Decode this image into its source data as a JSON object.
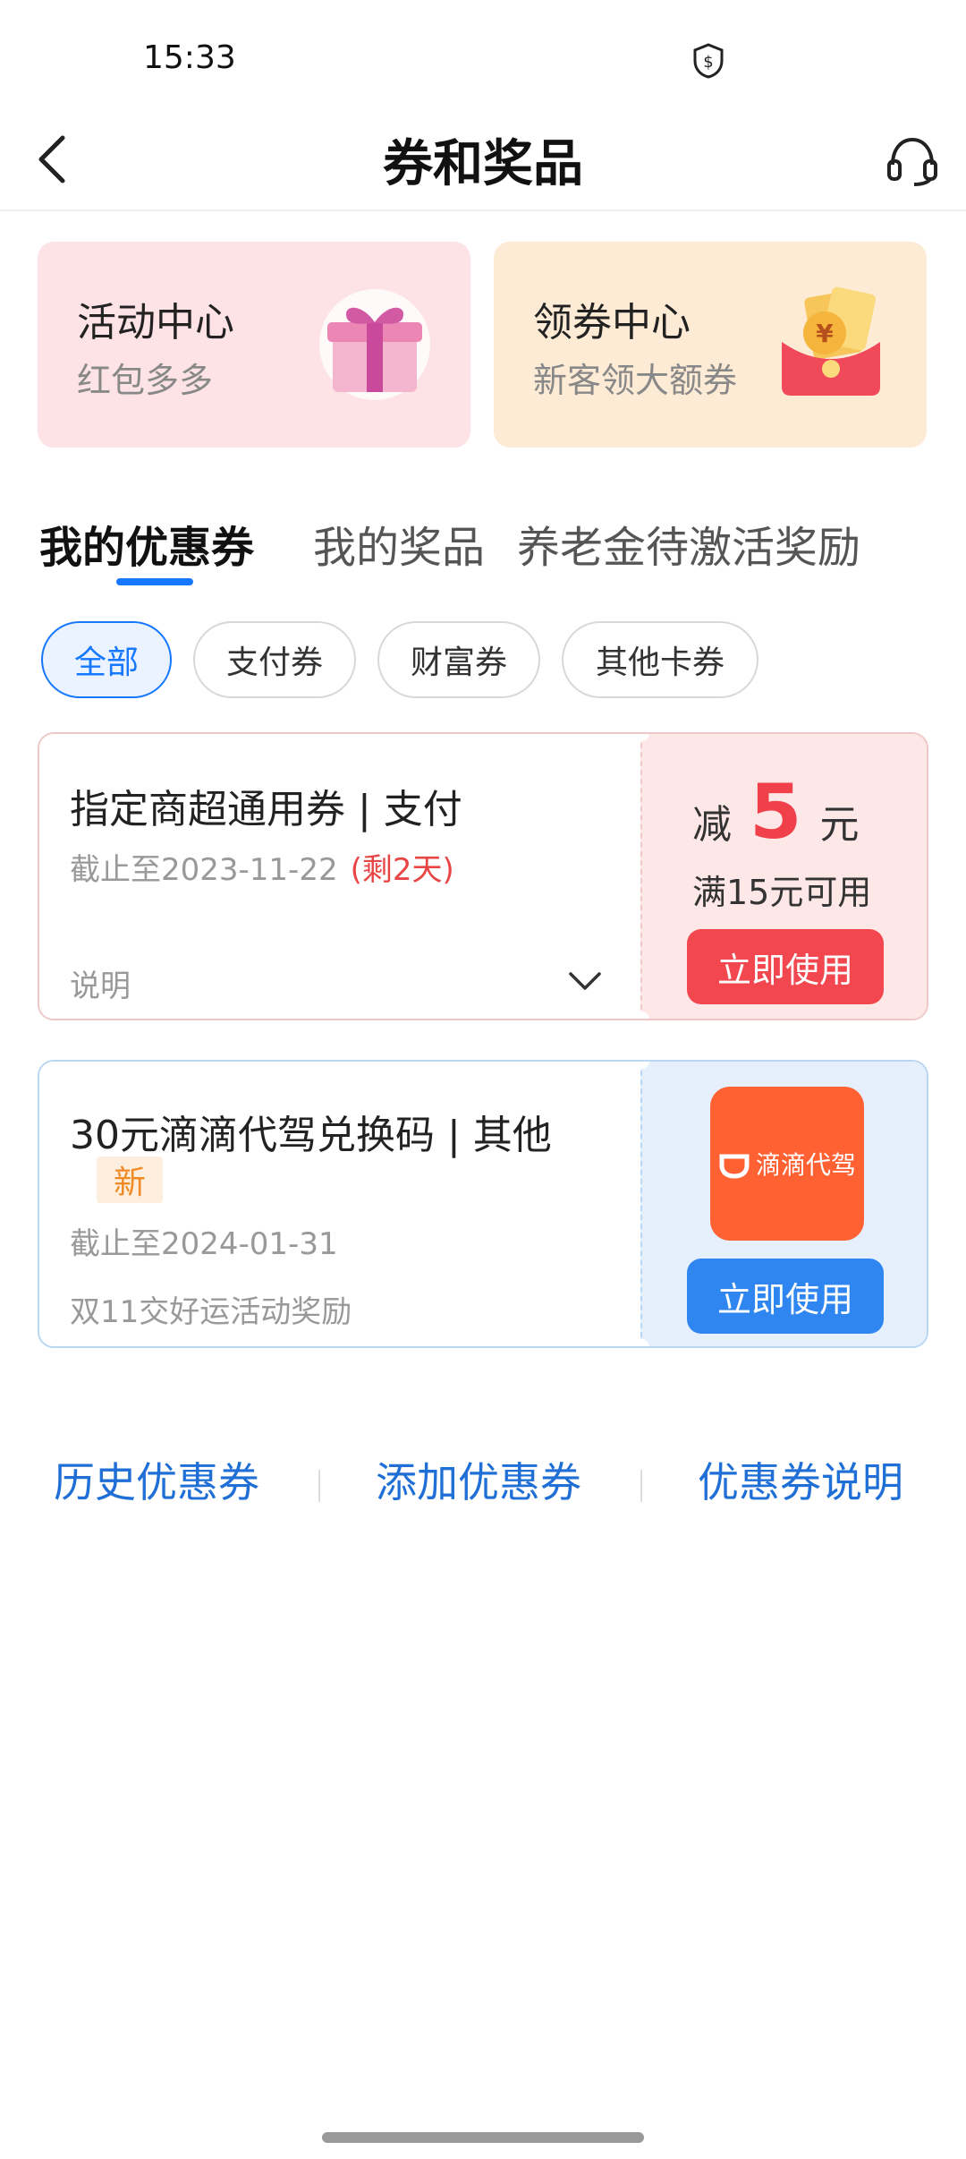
{
  "status_bar": {
    "time": "15:33",
    "shield_icon": "shield-dollar-icon"
  },
  "nav": {
    "title": "券和奖品",
    "back_icon": "chevron-left-icon",
    "service_icon": "headset-icon"
  },
  "promos": [
    {
      "title": "活动中心",
      "subtitle": "红包多多",
      "icon": "gift-box-icon"
    },
    {
      "title": "领券中心",
      "subtitle": "新客领大额券",
      "icon": "red-envelope-icon"
    }
  ],
  "tabs": [
    {
      "label": "我的优惠券",
      "active": true
    },
    {
      "label": "我的奖品",
      "active": false
    },
    {
      "label": "养老金待激活奖励",
      "active": false
    }
  ],
  "filters": [
    {
      "label": "全部",
      "active": true
    },
    {
      "label": "支付券",
      "active": false
    },
    {
      "label": "财富券",
      "active": false
    },
    {
      "label": "其他卡券",
      "active": false
    }
  ],
  "coupons": [
    {
      "title": "指定商超通用券 | 支付",
      "expiry": "截止至2023-11-22",
      "remaining": "(剩2天)",
      "note": "说明",
      "reduce_label": "减",
      "amount": "5",
      "unit": "元",
      "condition": "满15元可用",
      "button": "立即使用"
    },
    {
      "title": "30元滴滴代驾兑换码 | 其他",
      "badge": "新",
      "expiry": "截止至2024-01-31",
      "note": "双11交好运活动奖励",
      "logo_text": "滴滴代驾",
      "button": "立即使用"
    }
  ],
  "bottom_links": [
    "历史优惠券",
    "添加优惠券",
    "优惠券说明"
  ],
  "colors": {
    "accent": "#1677ff",
    "red": "#f2474e",
    "link": "#1f6fd6"
  }
}
